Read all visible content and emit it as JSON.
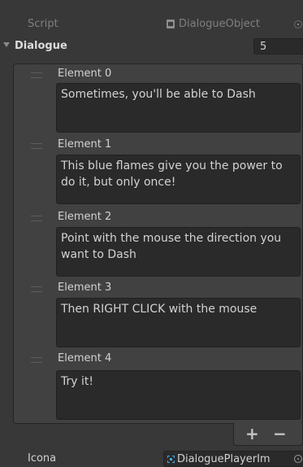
{
  "script_field": {
    "label": "Script",
    "value": "DialogueObject"
  },
  "dialogue": {
    "label": "Dialogue",
    "size": "5"
  },
  "elements": [
    {
      "label": "Element 0",
      "text": "Sometimes, you'll be able to Dash"
    },
    {
      "label": "Element 1",
      "text": "This blue flames give you the power to do it, but only once!"
    },
    {
      "label": "Element 2",
      "text": "Point with the mouse the direction you want to Dash"
    },
    {
      "label": "Element 3",
      "text": "Then RIGHT CLICK with the mouse"
    },
    {
      "label": "Element 4",
      "text": "Try it!"
    }
  ],
  "list_buttons": {
    "add": "+",
    "remove": "−"
  },
  "icona_field": {
    "label": "Icona",
    "value": "DialoguePlayerIm"
  }
}
